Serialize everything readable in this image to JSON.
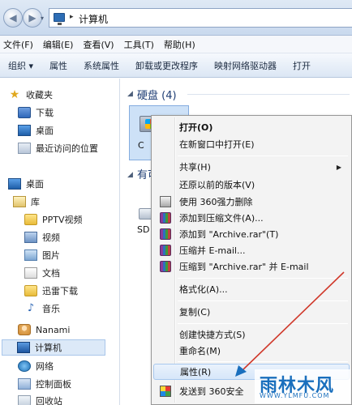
{
  "address_bar": {
    "back_glyph": "◀",
    "forward_glyph": "▶",
    "separator": "▸",
    "crumb": "计算机"
  },
  "menu": {
    "items": [
      "文件(F)",
      "编辑(E)",
      "查看(V)",
      "工具(T)",
      "帮助(H)"
    ]
  },
  "toolbar": {
    "items": [
      "组织 ▾",
      "属性",
      "系统属性",
      "卸载或更改程序",
      "映射网络驱动器",
      "打开"
    ]
  },
  "nav_pane": {
    "favorites": "收藏夹",
    "fav_items": [
      "下载",
      "桌面",
      "最近访问的位置"
    ],
    "desktop": "桌面",
    "library": "库",
    "lib_items": [
      "PPTV视频",
      "视频",
      "图片",
      "文档",
      "迅雷下载",
      "音乐"
    ],
    "user": "Nanami",
    "computer": "计算机",
    "network": "网络",
    "control_panel": "控制面板",
    "recycle_bin": "回收站"
  },
  "content": {
    "hdd_group": "硬盘 (4)",
    "drive_label": "C",
    "removable_group": "有可",
    "sd_label": "SD"
  },
  "context_menu": {
    "open": "打开(O)",
    "open_new_window": "在新窗口中打开(E)",
    "share": "共享(H)",
    "restore": "还原以前的版本(V)",
    "delete_360": "使用 360强力删除",
    "add_archive": "添加到压缩文件(A)...",
    "add_archive_rar": "添加到 \"Archive.rar\"(T)",
    "compress_email": "压缩并 E-mail...",
    "compress_rar_email": "压缩到 \"Archive.rar\" 并 E-mail",
    "format": "格式化(A)...",
    "copy": "复制(C)",
    "create_shortcut": "创建快捷方式(S)",
    "rename": "重命名(M)",
    "properties": "属性(R)",
    "send_to_360": "发送到 360安全"
  },
  "watermark": {
    "title": "雨林木风",
    "url": "WWW.YLMFU.COM"
  },
  "colors": {
    "highlight": "#d6e6f9",
    "annotation_arrow": "#d0392b"
  }
}
